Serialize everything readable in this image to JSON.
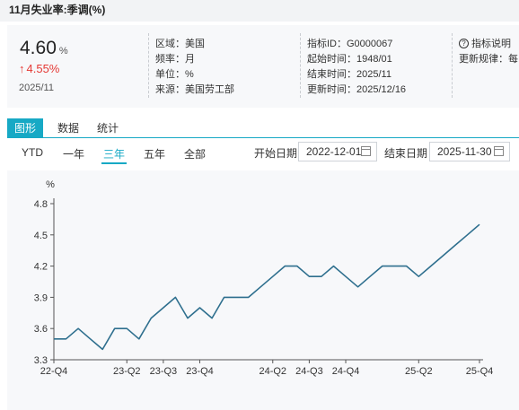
{
  "window": {
    "title": "11月失业率:季调(%)"
  },
  "summary": {
    "value": "4.60",
    "unit": "%",
    "arrow": "↑",
    "change": "4.55%",
    "period": "2025/11"
  },
  "meta": {
    "region": "区域：美国",
    "frequency": "频率：月",
    "unit": "单位：%",
    "source": "来源：美国劳工部",
    "indicator_id": "指标ID：G0000067",
    "start_time": "起始时间：1948/01",
    "end_time": "结束时间：2025/11",
    "update_time": "更新时间：2025/12/16",
    "help_label": "指标说明",
    "update_rule": "更新规律：每"
  },
  "tabs": [
    "图形",
    "数据",
    "统计"
  ],
  "ranges": [
    "YTD",
    "一年",
    "三年",
    "五年",
    "全部"
  ],
  "date_filter": {
    "start_label": "开始日期",
    "start_value": "2022-12-01",
    "end_label": "结束日期",
    "end_value": "2025-11-30"
  },
  "colors": {
    "accent": "#17a9c5",
    "line": "#2e6f8e",
    "up": "#e53935"
  },
  "icons": {
    "help": "help-circle-icon",
    "calendar": "calendar-icon",
    "arrow": "arrow-up-icon"
  },
  "chart_data": {
    "type": "line",
    "ylabel": "%",
    "ylim": [
      3.3,
      4.8
    ],
    "yticks": [
      "3.3",
      "3.6",
      "3.9",
      "4.2",
      "4.5",
      "4.8"
    ],
    "xticks": [
      "22-Q4",
      "23-Q2",
      "23-Q3",
      "23-Q4",
      "24-Q2",
      "24-Q3",
      "24-Q4",
      "25-Q2",
      "25-Q4"
    ],
    "x": [
      "2022-12",
      "2023-01",
      "2023-02",
      "2023-03",
      "2023-04",
      "2023-05",
      "2023-06",
      "2023-07",
      "2023-08",
      "2023-09",
      "2023-10",
      "2023-11",
      "2023-12",
      "2024-01",
      "2024-02",
      "2024-03",
      "2024-04",
      "2024-05",
      "2024-06",
      "2024-07",
      "2024-08",
      "2024-09",
      "2024-10",
      "2024-11",
      "2024-12",
      "2025-01",
      "2025-02",
      "2025-03",
      "2025-04",
      "2025-05",
      "2025-06",
      "2025-07",
      "2025-08",
      "2025-09",
      "2025-10",
      "2025-11"
    ],
    "values": [
      3.5,
      3.5,
      3.6,
      3.5,
      3.4,
      3.6,
      3.6,
      3.5,
      3.7,
      3.8,
      3.9,
      3.7,
      3.8,
      3.7,
      3.9,
      3.9,
      3.9,
      4.0,
      4.1,
      4.2,
      4.2,
      4.1,
      4.1,
      4.2,
      4.1,
      4.0,
      4.1,
      4.2,
      4.2,
      4.2,
      4.1,
      4.2,
      4.3,
      4.4,
      4.5,
      4.6
    ],
    "grid": false,
    "legend": "none"
  }
}
